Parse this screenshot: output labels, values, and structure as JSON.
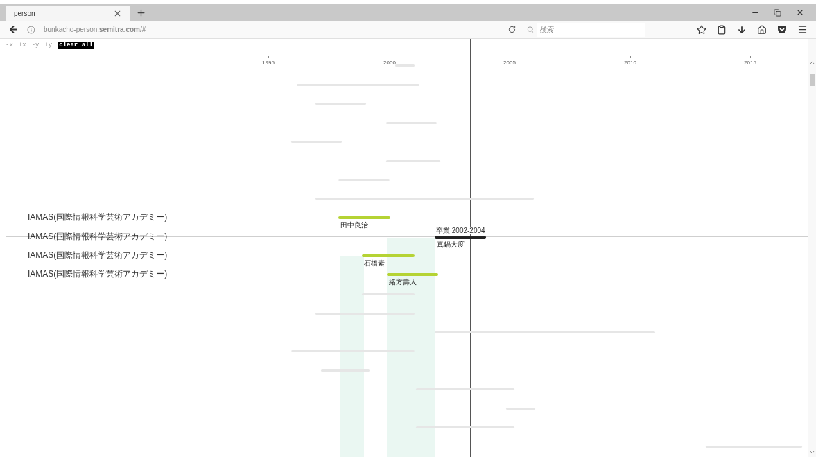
{
  "browser": {
    "tab": {
      "title": "person",
      "selected": true
    },
    "address": "bunkacho-person.**semitra.com**/#",
    "search": {
      "placeholder": "検索"
    }
  },
  "controls": [
    "-x",
    "+x",
    "-y",
    "+y"
  ],
  "clear_button": "clear all",
  "axis": {
    "ticks": [
      "1995",
      "2000",
      "2005",
      "2010",
      "2015"
    ]
  },
  "rows": [
    {
      "kind": "faint"
    },
    {
      "kind": "faint"
    },
    {
      "kind": "faint"
    },
    {
      "kind": "faint"
    },
    {
      "kind": "faint"
    },
    {
      "kind": "faint"
    },
    {
      "kind": "faint"
    },
    {
      "kind": "faint"
    },
    {
      "kind": "highlight",
      "institution": "IAMAS(国際情報科学芸術アカデミー)",
      "name": "田中良治"
    },
    {
      "kind": "current",
      "institution": "IAMAS(国際情報科学芸術アカデミー)",
      "name": "真鍋大度",
      "note": "卒業 2002-2004"
    },
    {
      "kind": "highlight",
      "institution": "IAMAS(国際情報科学芸術アカデミー)",
      "name": "石橋素"
    },
    {
      "kind": "highlight",
      "institution": "IAMAS(国際情報科学芸術アカデミー)",
      "name": "緒方壽人"
    },
    {
      "kind": "faint"
    },
    {
      "kind": "faint"
    },
    {
      "kind": "faint"
    },
    {
      "kind": "faint"
    },
    {
      "kind": "faint"
    },
    {
      "kind": "faint"
    },
    {
      "kind": "faint"
    },
    {
      "kind": "faint"
    },
    {
      "kind": "faint"
    }
  ]
}
